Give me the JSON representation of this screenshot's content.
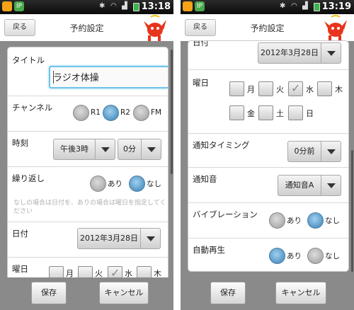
{
  "left": {
    "status": {
      "time": "13:18"
    },
    "header": {
      "back_label": "戻る",
      "title": "予約設定"
    },
    "form": {
      "title_label": "タイトル",
      "title_value": "ラジオ体操",
      "channel_label": "チャンネル",
      "channels": [
        {
          "label": "R1",
          "selected": false
        },
        {
          "label": "R2",
          "selected": true
        },
        {
          "label": "FM",
          "selected": false
        }
      ],
      "time_label": "時刻",
      "hour_value": "午後3時",
      "minute_value": "0分",
      "repeat_label": "繰り返し",
      "repeat_options": [
        {
          "label": "あり",
          "selected": false
        },
        {
          "label": "なし",
          "selected": true
        }
      ],
      "repeat_note": "なしの場合は日付を、ありの場合は曜日を指定してください",
      "date_label": "日付",
      "date_value": "2012年3月28日",
      "weekday_label": "曜日",
      "weekdays": [
        {
          "label": "月",
          "checked": false
        },
        {
          "label": "火",
          "checked": false
        },
        {
          "label": "水",
          "checked": true
        },
        {
          "label": "木",
          "checked": false
        }
      ]
    },
    "footer": {
      "save_label": "保存",
      "cancel_label": "キャンセル"
    }
  },
  "right": {
    "status": {
      "time": "13:19"
    },
    "header": {
      "back_label": "戻る",
      "title": "予約設定"
    },
    "form": {
      "date_label_partial": "日付",
      "date_value": "2012年3月28日",
      "weekday_label": "曜日",
      "weekdays": [
        {
          "label": "月",
          "checked": false
        },
        {
          "label": "火",
          "checked": false
        },
        {
          "label": "水",
          "checked": true
        },
        {
          "label": "木",
          "checked": false
        },
        {
          "label": "金",
          "checked": false
        },
        {
          "label": "土",
          "checked": false
        },
        {
          "label": "日",
          "checked": false
        }
      ],
      "notify_timing_label": "通知タイミング",
      "notify_timing_value": "0分前",
      "notify_sound_label": "通知音",
      "notify_sound_value": "通知音A",
      "vibration_label": "バイブレーション",
      "vibration_options": [
        {
          "label": "あり",
          "selected": false
        },
        {
          "label": "なし",
          "selected": true
        }
      ],
      "autoplay_label": "自動再生",
      "autoplay_options": [
        {
          "label": "あり",
          "selected": true
        },
        {
          "label": "なし",
          "selected": false
        }
      ]
    },
    "footer": {
      "save_label": "保存",
      "cancel_label": "キャンセル"
    }
  },
  "colors": {
    "accent": "#6fc4ea",
    "radio_on": "#3a7fb4",
    "background": "#8a8a8a",
    "statusbar": "#111111"
  }
}
